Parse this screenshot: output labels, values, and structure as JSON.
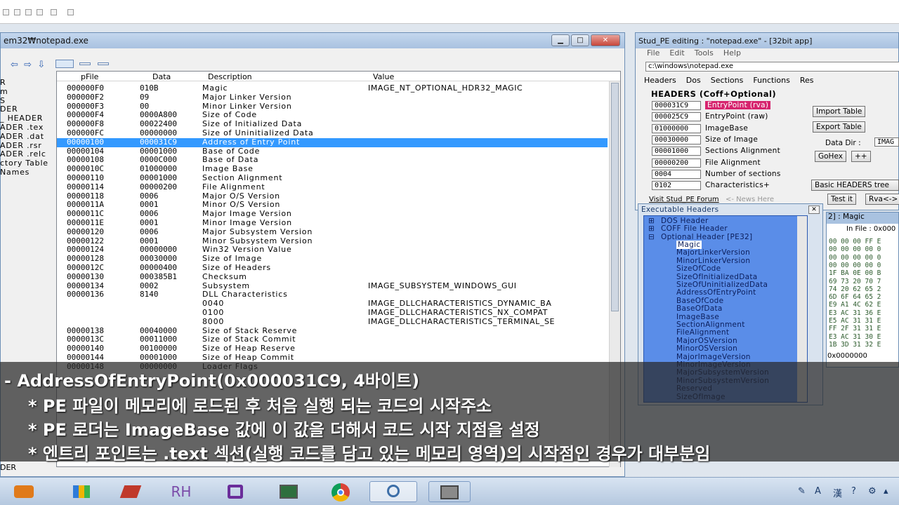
{
  "left_window": {
    "title": "em32₩notepad.exe",
    "columns": [
      "pFile",
      "Data",
      "Description",
      "Value"
    ],
    "tree": [
      "R",
      "m",
      "S",
      "DER",
      "_ HEADER",
      "ADER .tex",
      "ADER .dat",
      "ADER .rsr",
      "ADER .relc",
      "ctory Table",
      "Names"
    ],
    "rows": [
      [
        "000000F0",
        "010B",
        "Magic",
        "IMAGE_NT_OPTIONAL_HDR32_MAGIC"
      ],
      [
        "000000F2",
        "09",
        "Major Linker Version",
        ""
      ],
      [
        "000000F3",
        "00",
        "Minor Linker Version",
        ""
      ],
      [
        "000000F4",
        "0000A800",
        "Size of Code",
        ""
      ],
      [
        "000000F8",
        "00022400",
        "Size of Initialized Data",
        ""
      ],
      [
        "000000FC",
        "00000000",
        "Size of Uninitialized Data",
        ""
      ],
      [
        "00000100",
        "000031C9",
        "Address of Entry Point",
        ""
      ],
      [
        "00000104",
        "00001000",
        "Base of Code",
        ""
      ],
      [
        "00000108",
        "0000C000",
        "Base of Data",
        ""
      ],
      [
        "0000010C",
        "01000000",
        "Image Base",
        ""
      ],
      [
        "00000110",
        "00001000",
        "Section Alignment",
        ""
      ],
      [
        "00000114",
        "00000200",
        "File Alignment",
        ""
      ],
      [
        "00000118",
        "0006",
        "Major O/S Version",
        ""
      ],
      [
        "0000011A",
        "0001",
        "Minor O/S Version",
        ""
      ],
      [
        "0000011C",
        "0006",
        "Major Image Version",
        ""
      ],
      [
        "0000011E",
        "0001",
        "Minor Image Version",
        ""
      ],
      [
        "00000120",
        "0006",
        "Major Subsystem Version",
        ""
      ],
      [
        "00000122",
        "0001",
        "Minor Subsystem Version",
        ""
      ],
      [
        "00000124",
        "00000000",
        "Win32 Version Value",
        ""
      ],
      [
        "00000128",
        "00030000",
        "Size of Image",
        ""
      ],
      [
        "0000012C",
        "00000400",
        "Size of Headers",
        ""
      ],
      [
        "00000130",
        "000385B1",
        "Checksum",
        ""
      ],
      [
        "00000134",
        "0002",
        "Subsystem",
        "IMAGE_SUBSYSTEM_WINDOWS_GUI"
      ],
      [
        "00000136",
        "8140",
        "DLL Characteristics",
        ""
      ],
      [
        "",
        "",
        "0040",
        "IMAGE_DLLCHARACTERISTICS_DYNAMIC_BA"
      ],
      [
        "",
        "",
        "0100",
        "IMAGE_DLLCHARACTERISTICS_NX_COMPAT"
      ],
      [
        "",
        "",
        "8000",
        "IMAGE_DLLCHARACTERISTICS_TERMINAL_SE"
      ],
      [
        "00000138",
        "00040000",
        "Size of Stack Reserve",
        ""
      ],
      [
        "0000013C",
        "00011000",
        "Size of Stack Commit",
        ""
      ],
      [
        "00000140",
        "00100000",
        "Size of Heap Reserve",
        ""
      ],
      [
        "00000144",
        "00001000",
        "Size of Heap Commit",
        ""
      ],
      [
        "00000148",
        "00000000",
        "Loader Flags",
        ""
      ]
    ],
    "bottom_label": "DER"
  },
  "stud": {
    "title": "Stud_PE editing : \"notepad.exe\" - [32bit app]",
    "menu": [
      "File",
      "Edit",
      "Tools",
      "Help"
    ],
    "path": "c:\\windows\\notepad.exe",
    "tabs": [
      "Headers",
      "Dos",
      "Sections",
      "Functions",
      "Res"
    ],
    "section_title": "HEADERS (Coff+Optional)",
    "headers": [
      [
        "000031C9",
        "EntryPoint (rva)"
      ],
      [
        "000025C9",
        "EntryPoint (raw)"
      ],
      [
        "01000000",
        "ImageBase"
      ],
      [
        "00030000",
        "Size of Image"
      ],
      [
        "00001000",
        "Sections Alignment"
      ],
      [
        "00000200",
        "File Alignment"
      ],
      [
        "0004",
        "Number of sections"
      ],
      [
        "0102",
        "Characteristics+"
      ]
    ],
    "import_btn": "Import Table",
    "export_btn": "Export Table",
    "datadir_label": "Data Dir :",
    "datadir_val": "IMAG",
    "gohex": "GoHex",
    "plusplus": "++",
    "basic": "Basic HEADERS tree",
    "visit": "Visit Stud_PE Forum",
    "news": "<- News Here",
    "testit": "Test it",
    "rva": "Rva<->",
    "magic_label": "2] : Magic",
    "infile": "In File : 0x000",
    "small_val": "0x0000000"
  },
  "exec_headers": {
    "title": "Executable Headers",
    "items": [
      "DOS Header",
      "COFF File Header",
      "Optional Header [PE32]"
    ],
    "children": [
      "Magic",
      "MajorLinkerVersion",
      "MinorLinkerVersion",
      "SizeOfCode",
      "SizeOfInitializedData",
      "SizeOfUninitializedData",
      "AddressOfEntryPoint",
      "BaseOfCode",
      "BaseOfData",
      "ImageBase",
      "SectionAlignment",
      "FileAlignment",
      "MajorOSVersion",
      "MinorOSVersion",
      "MajorImageVersion",
      "MinorImageVersion",
      "MajorSubsystemVersion",
      "MinorSubsystemVersion",
      "Reserved",
      "SizeOfImage"
    ]
  },
  "hex_rows": [
    "00 00 00 FF E",
    "00 00 00 00 0",
    "00 00 00 00 0",
    "00 00 00 00 0",
    "1F BA 0E 00 B",
    "69 73 20 70 7",
    "74 20 62 65 2",
    "6D 6F 64 65 2",
    "E9 A1 4C 62 E",
    "E3 AC 31 36 E",
    "E5 AC 31 31 E",
    "FF 2F 31 31 E",
    "E3 AC 31 30 E",
    "1B 3D 31 32 E"
  ],
  "overlay": [
    "- AddressOfEntryPoint(0x000031C9, 4바이트)",
    "* PE 파일이 메모리에 로드된 후 처음 실행 되는 코드의 시작주소",
    "* PE 로더는 ImageBase 값에 이 값을 더해서 코드 시작 지점을 설정",
    "* 엔트리 포인트는 .text 섹션(실행 코드를 담고 있는 메모리 영역)의 시작점인 경우가 대부분임"
  ],
  "taskbar": {
    "rh": "RH"
  },
  "tray": {
    "a": "A",
    "han": "漢"
  }
}
